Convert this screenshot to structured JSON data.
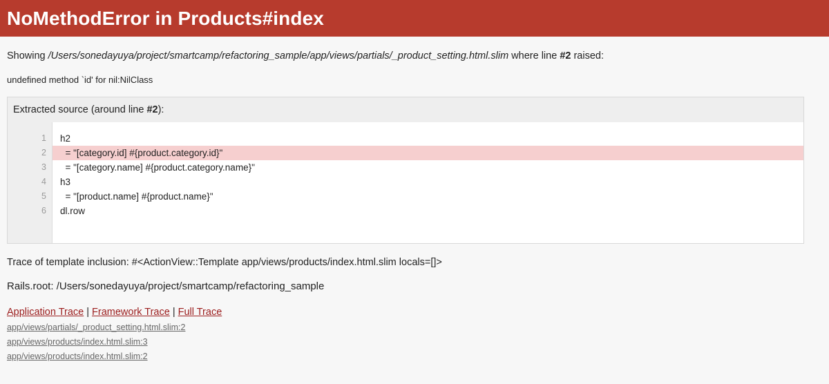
{
  "header": {
    "title": "NoMethodError in Products#index"
  },
  "showing": {
    "prefix": "Showing ",
    "path": "/Users/sonedayuya/project/smartcamp/refactoring_sample/app/views/partials/_product_setting.html.slim",
    "middle": " where line ",
    "line": "#2",
    "suffix": " raised:"
  },
  "error_message": "undefined method `id' for nil:NilClass",
  "source": {
    "title_prefix": "Extracted source (around line ",
    "title_line": "#2",
    "title_suffix": "):",
    "line_numbers": [
      "1",
      "2",
      "3",
      "4",
      "5",
      "6"
    ],
    "lines": [
      "h2",
      "  = \"[category.id] #{product.category.id}\"",
      "  = \"[category.name] #{product.category.name}\"",
      "h3",
      "  = \"[product.name] #{product.name}\"",
      "dl.row"
    ],
    "highlight_color": "#f6cfcf"
  },
  "trace_inclusion": "Trace of template inclusion: #<ActionView::Template app/views/products/index.html.slim locals=[]>",
  "rails_root": "Rails.root: /Users/sonedayuya/project/smartcamp/refactoring_sample",
  "trace_links": {
    "application": "Application Trace",
    "framework": "Framework Trace",
    "full": "Full Trace",
    "separator": "|"
  },
  "frames": [
    "app/views/partials/_product_setting.html.slim:2",
    "app/views/products/index.html.slim:3",
    "app/views/products/index.html.slim:2"
  ],
  "colors": {
    "header_bg": "#b73b2d",
    "link": "#9b1c1c"
  }
}
